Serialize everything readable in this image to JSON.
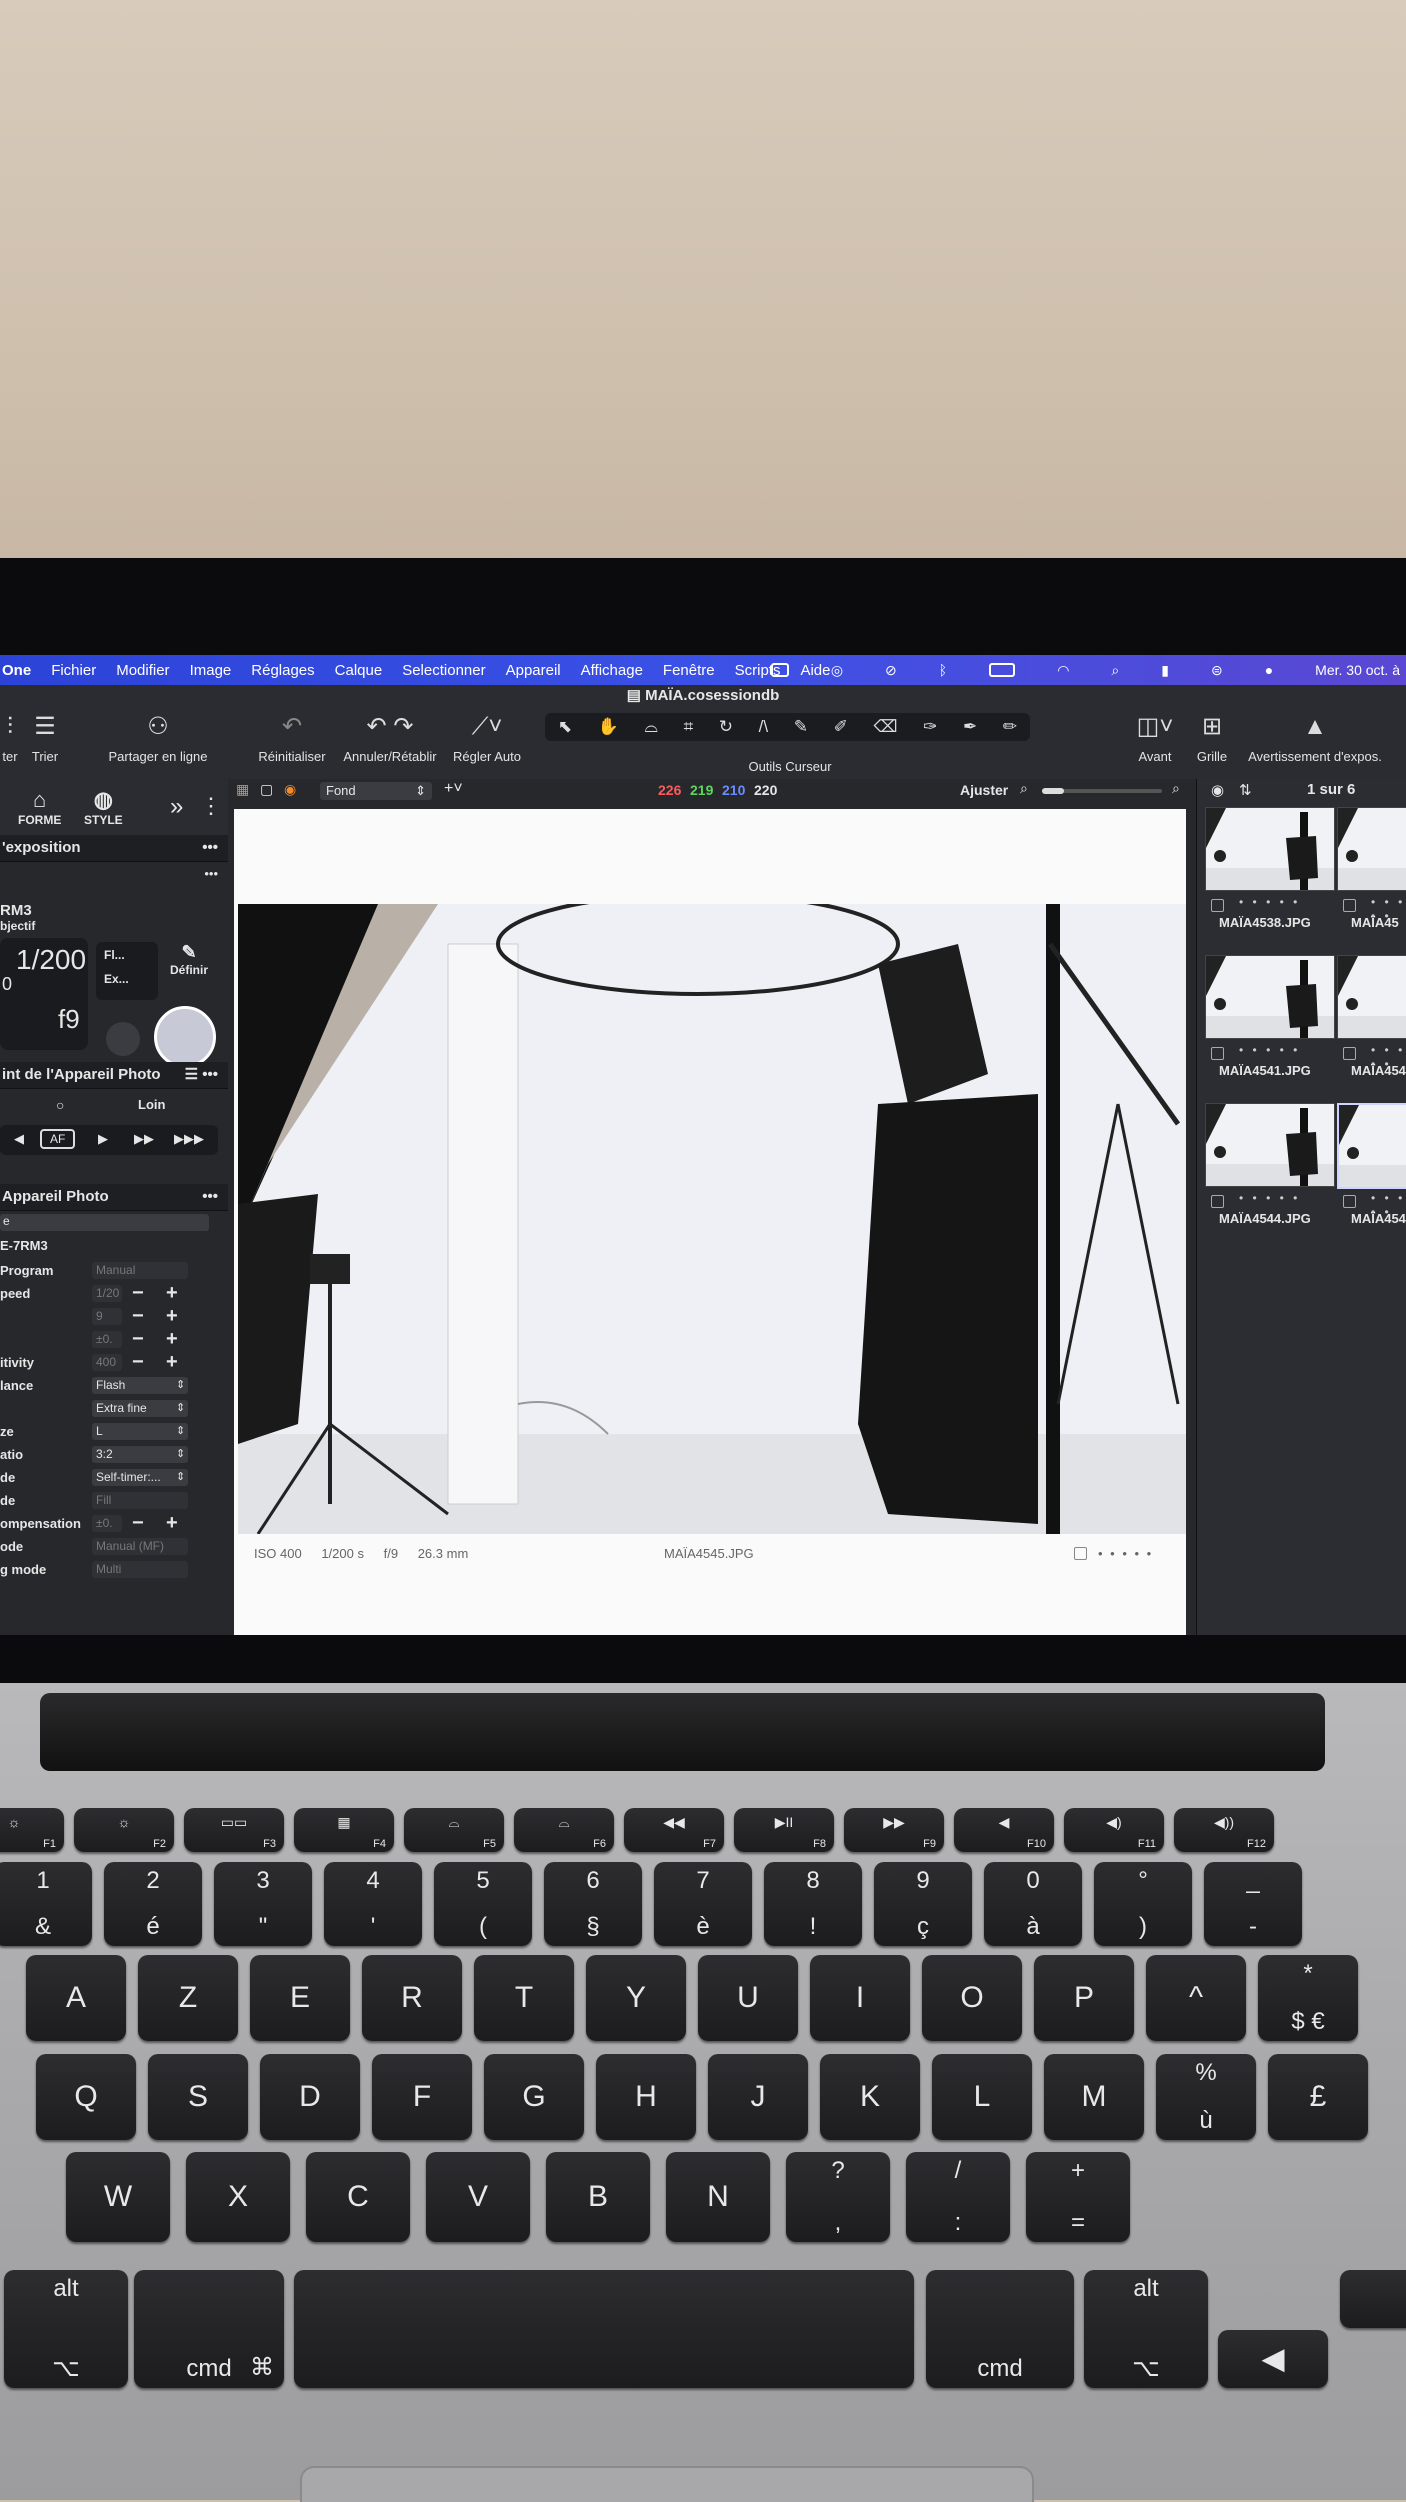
{
  "menubar": {
    "app": "One",
    "items": [
      "Fichier",
      "Modifier",
      "Image",
      "Réglages",
      "Calque",
      "Selectionner",
      "Appareil",
      "Affichage",
      "Fenêtre",
      "Scripts",
      "Aide"
    ],
    "clock": "Mer. 30 oct. à"
  },
  "window": {
    "title": "MAÏA.cosessiondb"
  },
  "toolbar": {
    "filter": "ter",
    "trier": "Trier",
    "partager": "Partager en ligne",
    "reinitialiser": "Réinitialiser",
    "annuler": "Annuler/Rétablir",
    "regler_auto": "Régler Auto",
    "outils_curseur": "Outils Curseur",
    "avant": "Avant",
    "grille": "Grille",
    "avertissement": "Avertissement d'expos."
  },
  "left_panel": {
    "tabs": [
      "FORME",
      "STYLE"
    ],
    "exposure_title": "'exposition",
    "camera_model": "RM3",
    "objectif": "bjectif",
    "shutter": "1/200",
    "aperture": "f9",
    "exp_comp": "0",
    "flash_short": "Fl...",
    "ext_short": "Ex...",
    "definir": "Définir",
    "focus_title": "int de l'Appareil Photo",
    "loin": "Loin",
    "af": "AF",
    "camera_title": "Appareil Photo",
    "camera_field": "e",
    "camera_name": "E-7RM3",
    "settings": [
      {
        "label": "Program",
        "value": "Manual",
        "dim": true,
        "pm": false
      },
      {
        "label": "peed",
        "value": "1/20",
        "dim": true,
        "pm": true
      },
      {
        "label": "",
        "value": "9",
        "dim": true,
        "pm": true
      },
      {
        "label": "",
        "value": "±0.",
        "dim": true,
        "pm": true
      },
      {
        "label": "itivity",
        "value": "400",
        "dim": true,
        "pm": true
      },
      {
        "label": "lance",
        "value": "Flash",
        "dim": false,
        "pm": false
      },
      {
        "label": "",
        "value": "Extra fine",
        "dim": false,
        "pm": false
      },
      {
        "label": "ze",
        "value": "L",
        "dim": false,
        "pm": false
      },
      {
        "label": "atio",
        "value": "3:2",
        "dim": false,
        "pm": false
      },
      {
        "label": "de",
        "value": "Self-timer:...",
        "dim": false,
        "pm": false
      },
      {
        "label": "de",
        "value": "Fill",
        "dim": true,
        "pm": false
      },
      {
        "label": "ompensation",
        "value": "±0.",
        "dim": true,
        "pm": true
      },
      {
        "label": "ode",
        "value": "Manual (MF)",
        "dim": true,
        "pm": false
      },
      {
        "label": "g mode",
        "value": "Multi",
        "dim": true,
        "pm": false
      }
    ]
  },
  "viewer_bar": {
    "layer": "Fond",
    "r": "226",
    "g": "219",
    "b": "210",
    "a": "220",
    "fit": "Ajuster"
  },
  "image_info": {
    "iso": "ISO 400",
    "shutter": "1/200 s",
    "aperture": "f/9",
    "focal": "26.3 mm",
    "filename": "MAÏA4545.JPG",
    "rating": "• • • • •"
  },
  "browser": {
    "counter": "1 sur 6",
    "thumbs": [
      {
        "name": "MAÏA4538.JPG"
      },
      {
        "name": "MAÏA45"
      },
      {
        "name": "MAÏA4541.JPG"
      },
      {
        "name": "MAÏA454"
      },
      {
        "name": "MAÏA4544.JPG"
      },
      {
        "name": "MAÏA454"
      }
    ],
    "rating": "• • • • •"
  },
  "keyboard": {
    "fn_row": [
      {
        "icon": "☼",
        "f": "F1"
      },
      {
        "icon": "☼",
        "f": "F2"
      },
      {
        "icon": "▭▭",
        "f": "F3"
      },
      {
        "icon": "▦",
        "f": "F4"
      },
      {
        "icon": "⌓",
        "f": "F5"
      },
      {
        "icon": "⌓",
        "f": "F6"
      },
      {
        "icon": "◀◀",
        "f": "F7"
      },
      {
        "icon": "▶II",
        "f": "F8"
      },
      {
        "icon": "▶▶",
        "f": "F9"
      },
      {
        "icon": "◀",
        "f": "F10"
      },
      {
        "icon": "◀)",
        "f": "F11"
      },
      {
        "icon": "◀))",
        "f": "F12"
      }
    ],
    "num_row": [
      {
        "t": "1",
        "b": "&"
      },
      {
        "t": "2",
        "b": "é"
      },
      {
        "t": "3",
        "b": "\""
      },
      {
        "t": "4",
        "b": "'"
      },
      {
        "t": "5",
        "b": "("
      },
      {
        "t": "6",
        "b": "§"
      },
      {
        "t": "7",
        "b": "è"
      },
      {
        "t": "8",
        "b": "!"
      },
      {
        "t": "9",
        "b": "ç"
      },
      {
        "t": "0",
        "b": "à"
      },
      {
        "t": "°",
        "b": ")"
      },
      {
        "t": "_",
        "b": "-"
      }
    ],
    "row_a": [
      "A",
      "Z",
      "E",
      "R",
      "T",
      "Y",
      "U",
      "I",
      "O",
      "P",
      "^",
      "*"
    ],
    "row_a_extra": "$ €",
    "row_q": [
      "Q",
      "S",
      "D",
      "F",
      "G",
      "H",
      "J",
      "K",
      "L",
      "M",
      "%",
      "£"
    ],
    "row_q_extra": "ù",
    "row_w": [
      "W",
      "X",
      "C",
      "V",
      "B",
      "N",
      "?",
      "/",
      "+"
    ],
    "row_w_sub": [
      "",
      "",
      "",
      "",
      "",
      "",
      ",",
      ":",
      "="
    ],
    "row_w_semicolon": ";",
    "alt_label": "alt",
    "cmd_label": "cmd",
    "alt_symbol": "⌥",
    "cmd_symbol": "⌘",
    "arrow_left": "◀"
  }
}
